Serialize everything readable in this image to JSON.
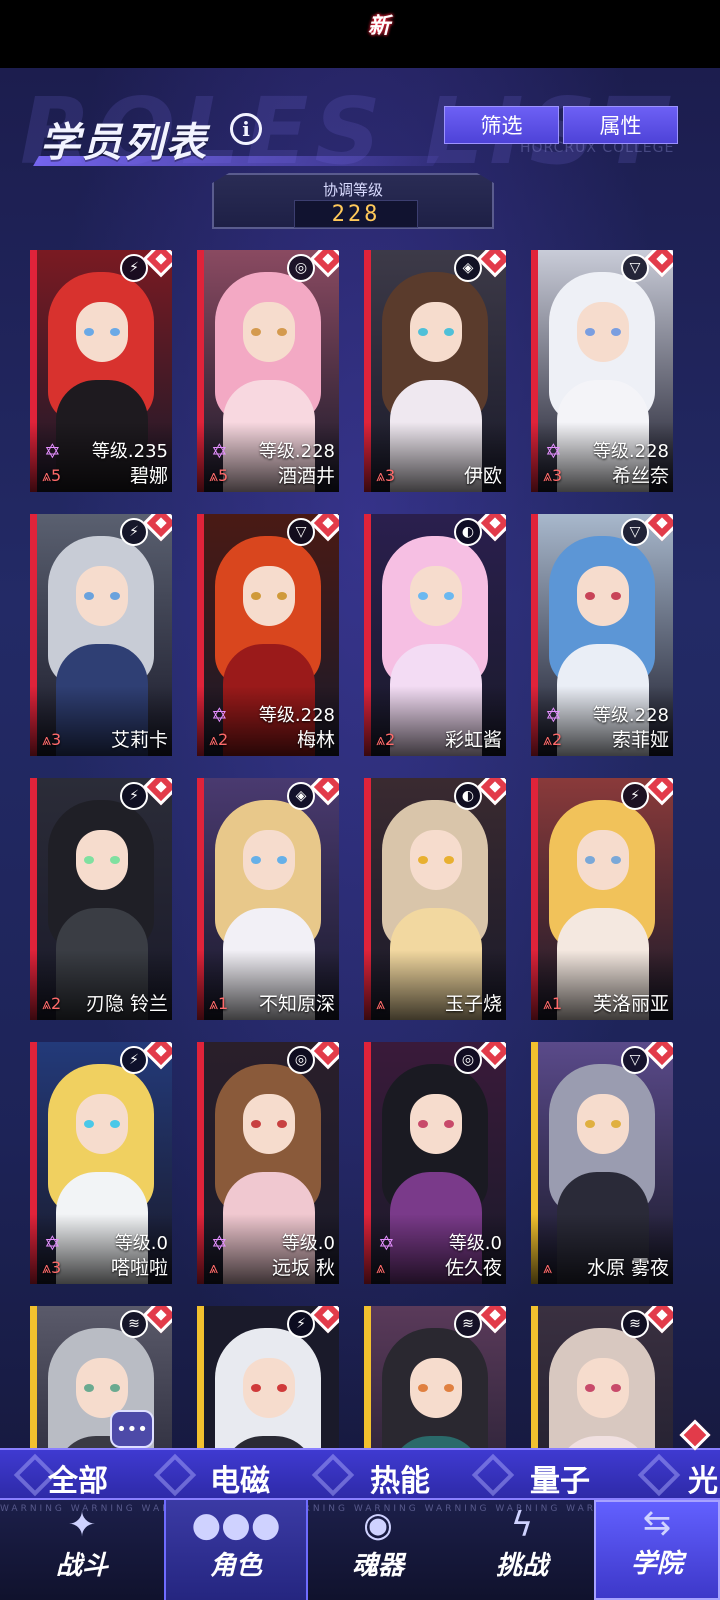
{
  "header": {
    "title": "学员列表",
    "info_icon": "info-icon",
    "watermark": "ROLES LIST",
    "watermark_small": "HORCRUX COLLEGE",
    "buttons": [
      {
        "label": "筛选"
      },
      {
        "label": "属性"
      }
    ]
  },
  "coordination": {
    "label": "协调等级",
    "value": "228"
  },
  "cards": [
    {
      "name": "碧娜",
      "level": "等级.235",
      "rank": "5",
      "rarity": "red",
      "element_icon": "electro-icon",
      "hair": "#d8322e",
      "eye": "#6aa9e6",
      "body": "#1e1a1f",
      "bg": "#7a1a22"
    },
    {
      "name": "酒酒井",
      "level": "等级.228",
      "rank": "5",
      "rarity": "red",
      "element_icon": "swirl-icon",
      "hair": "#f3a9c4",
      "eye": "#d49a4e",
      "body": "#f8d8e0",
      "bg": "#8a4a61"
    },
    {
      "name": "伊欧",
      "level": "",
      "rank": "3",
      "rarity": "red",
      "element_icon": "quantum-icon",
      "hair": "#5a3b2c",
      "eye": "#4fc0d8",
      "body": "#efe8f0",
      "bg": "#3d3a48"
    },
    {
      "name": "希丝奈",
      "level": "等级.228",
      "rank": "3",
      "rarity": "red",
      "element_icon": "void-icon",
      "hair": "#eef0f6",
      "eye": "#7a9ee0",
      "body": "#f4f4f8",
      "bg": "#c9ccd8"
    },
    {
      "name": "艾莉卡",
      "level": "",
      "rank": "3",
      "rarity": "red",
      "element_icon": "electro-icon",
      "hair": "#c8ccd6",
      "eye": "#6aa2dd",
      "body": "#2f3f74",
      "bg": "#5a6070"
    },
    {
      "name": "梅林",
      "level": "等级.228",
      "rank": "2",
      "rarity": "red",
      "element_icon": "void-icon",
      "hair": "#d9461e",
      "eye": "#d09a3a",
      "body": "#9a1a1a",
      "bg": "#4a1a14"
    },
    {
      "name": "彩虹酱",
      "level": "",
      "rank": "2",
      "rarity": "red",
      "element_icon": "thermal-icon",
      "hair": "#f6bfe3",
      "eye": "#6bb8f0",
      "body": "#f3dcf4",
      "bg": "#2a1f4e"
    },
    {
      "name": "索菲娅",
      "level": "等级.228",
      "rank": "2",
      "rarity": "red",
      "element_icon": "void-icon",
      "hair": "#5c96d6",
      "eye": "#c84458",
      "body": "#eaeef6",
      "bg": "#a8b8cc"
    },
    {
      "name": "刃隐 铃兰",
      "level": "",
      "rank": "2",
      "rarity": "red",
      "element_icon": "electro-icon",
      "hair": "#1f1f26",
      "eye": "#7fe0a0",
      "body": "#3a3d44",
      "bg": "#2b2c38"
    },
    {
      "name": "不知原深",
      "level": "",
      "rank": "1",
      "rarity": "red",
      "element_icon": "quantum-icon",
      "hair": "#e8c88a",
      "eye": "#66b0e8",
      "body": "#f2f0f6",
      "bg": "#4a3a70"
    },
    {
      "name": "玉子烧",
      "level": "",
      "rank": "",
      "rarity": "red",
      "element_icon": "thermal-icon",
      "hair": "#d9c5aa",
      "eye": "#e8b030",
      "body": "#f2d8a0",
      "bg": "#3a2a30"
    },
    {
      "name": "芙洛丽亚",
      "level": "",
      "rank": "1",
      "rarity": "red",
      "element_icon": "electro-icon",
      "hair": "#f1c25a",
      "eye": "#7aa8d8",
      "body": "#f4e8e0",
      "bg": "#8a3a3a"
    },
    {
      "name": "嗒啦啦",
      "level": "等级.0",
      "rank": "3",
      "rarity": "red",
      "element_icon": "electro-icon",
      "hair": "#f0d060",
      "eye": "#4ac8e8",
      "body": "#f2f4f6",
      "bg": "#233a7a"
    },
    {
      "name": "远坂 秋",
      "level": "等级.0",
      "rank": "",
      "rarity": "red",
      "element_icon": "swirl-icon",
      "hair": "#8a5a3a",
      "eye": "#c84040",
      "body": "#f0c8d0",
      "bg": "#2a1f2a"
    },
    {
      "name": "佐久夜",
      "level": "等级.0",
      "rank": "",
      "rarity": "red",
      "element_icon": "swirl-icon",
      "hair": "#1a1a22",
      "eye": "#c84a6a",
      "body": "#7a3a8a",
      "bg": "#3a1a3a"
    },
    {
      "name": "水原 雾夜",
      "level": "",
      "rank": "",
      "rarity": "gold",
      "element_icon": "void-icon",
      "hair": "#9a9cb0",
      "eye": "#e0b040",
      "body": "#2a2a38",
      "bg": "#5a4a8a"
    },
    {
      "name": "",
      "level": "",
      "rank": "",
      "rarity": "gold",
      "element_icon": "wifi-icon",
      "hair": "#b9bcc4",
      "eye": "#6aaa90",
      "body": "#3a3a44",
      "bg": "#5a5a6a"
    },
    {
      "name": "",
      "level": "",
      "rank": "",
      "rarity": "gold",
      "element_icon": "electro-icon",
      "hair": "#e8eaf0",
      "eye": "#d03a3a",
      "body": "#2a2a34",
      "bg": "#1a1a2a"
    },
    {
      "name": "",
      "level": "",
      "rank": "",
      "rarity": "gold",
      "element_icon": "wifi-icon",
      "hair": "#2a2830",
      "eye": "#e08040",
      "body": "#2a6a6a",
      "bg": "#5a3a5a"
    },
    {
      "name": "",
      "level": "",
      "rank": "",
      "rarity": "gold",
      "element_icon": "wifi-icon",
      "hair": "#d8c8c0",
      "eye": "#c84a6a",
      "body": "#f0e0e0",
      "bg": "#3a3040"
    }
  ],
  "filter_tabs": [
    {
      "label": "全部"
    },
    {
      "label": "电磁"
    },
    {
      "label": "热能"
    },
    {
      "label": "量子"
    },
    {
      "label": "光"
    }
  ],
  "bottom_nav": {
    "warning_text": "WARNING WARNING WARNING WARNING WARNING WARNING WARNING WARNING WARNING WARNING WARNING",
    "new_badge": "新",
    "items": [
      {
        "label": "战斗",
        "icon": "battle-icon"
      },
      {
        "label": "角色",
        "icon": "characters-icon"
      },
      {
        "label": "魂器",
        "icon": "soulware-icon"
      },
      {
        "label": "挑战",
        "icon": "challenge-icon"
      },
      {
        "label": "学院",
        "icon": "academy-icon"
      }
    ]
  },
  "colors": {
    "rarity_red": "#e0233a",
    "rarity_gold": "#f2c12e",
    "accent": "#5a50e8"
  }
}
